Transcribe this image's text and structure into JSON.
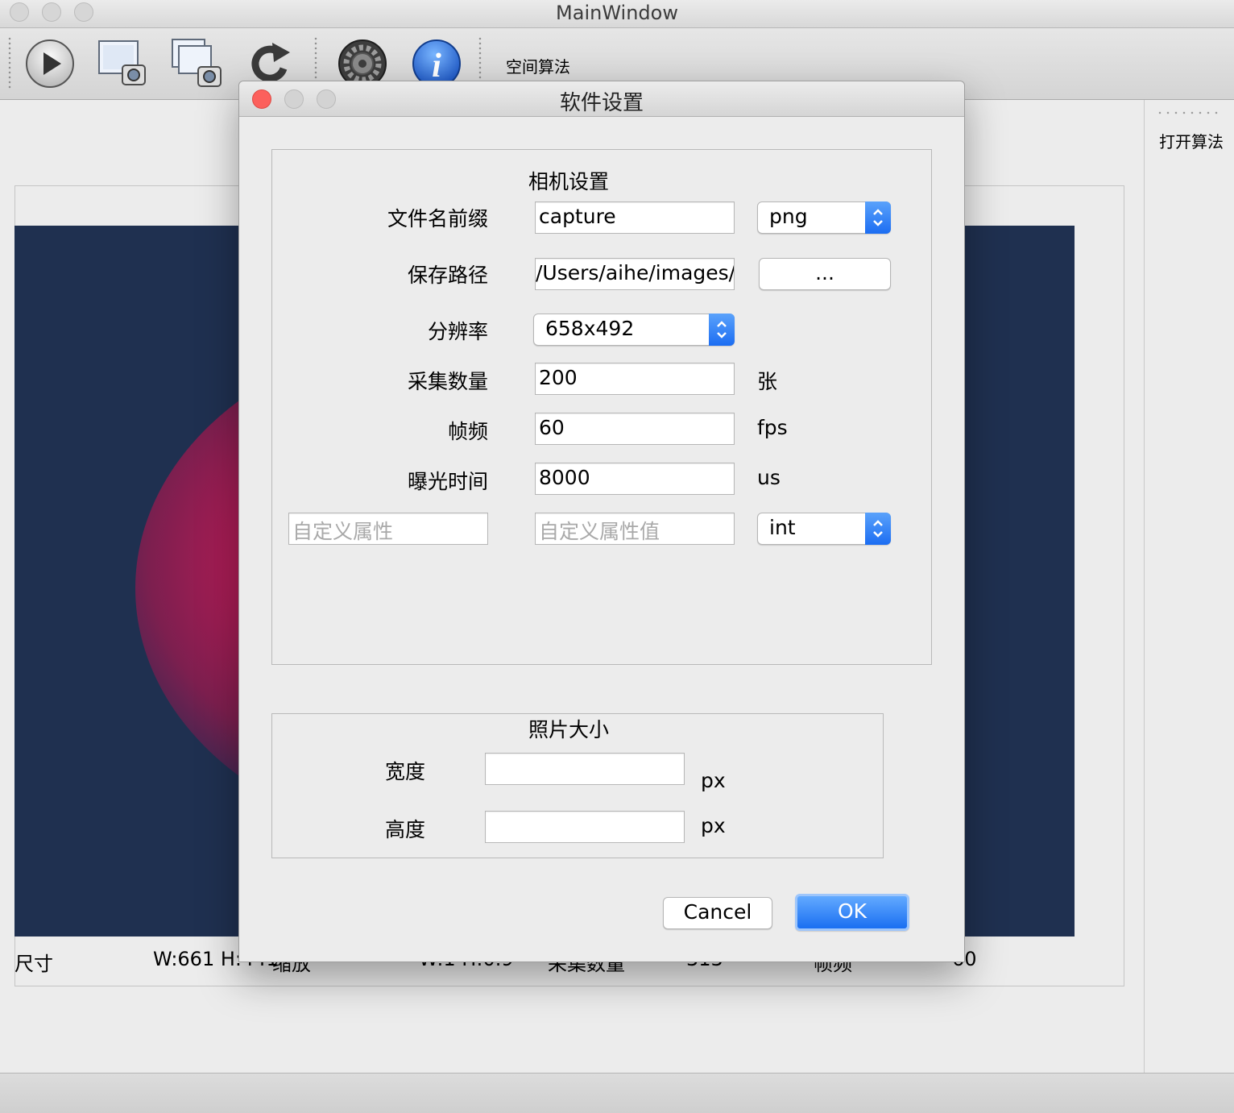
{
  "main_window": {
    "title": "MainWindow"
  },
  "toolbar": {
    "buttons": [
      {
        "name": "play-icon"
      },
      {
        "name": "capture-single-icon"
      },
      {
        "name": "capture-multi-icon"
      },
      {
        "name": "refresh-icon"
      },
      {
        "name": "settings-gear-icon"
      },
      {
        "name": "info-icon"
      }
    ],
    "space_algorithm_label": "空间算法"
  },
  "right_dock": {
    "open_algorithm_label": "打开算法"
  },
  "status_info": {
    "size_label": "尺寸",
    "size_value": "W:661 H:441",
    "zoom_label": "缩放",
    "zoom_value": "W:1 H:0.9",
    "capture_count_label": "采集数量",
    "capture_count_value": "313",
    "frame_rate_label": "帧频",
    "frame_rate_value": "60"
  },
  "dialog": {
    "title": "软件设置",
    "camera_group": {
      "title": "相机设置",
      "file_prefix_label": "文件名前缀",
      "file_prefix_value": "capture",
      "format_value": "png",
      "save_path_label": "保存路径",
      "save_path_value": "/Users/aihe/images/",
      "browse_label": "...",
      "resolution_label": "分辨率",
      "resolution_value": "658x492",
      "count_label": "采集数量",
      "count_value": "200",
      "count_unit": "张",
      "fps_label": "帧频",
      "fps_value": "60",
      "fps_unit": "fps",
      "exposure_label": "曝光时间",
      "exposure_value": "8000",
      "exposure_unit": "us",
      "custom_attr_placeholder": "自定义属性",
      "custom_value_placeholder": "自定义属性值",
      "custom_type_value": "int"
    },
    "photo_group": {
      "title": "照片大小",
      "width_label": "宽度",
      "width_value": "",
      "width_unit": "px",
      "height_label": "高度",
      "height_value": "",
      "height_unit": "px"
    },
    "cancel_label": "Cancel",
    "ok_label": "OK"
  },
  "colors": {
    "accent_blue": "#1c6df2",
    "close_red": "#fc605c",
    "camera_bg": "#1f3050",
    "blob_magenta": "#d8195a"
  }
}
